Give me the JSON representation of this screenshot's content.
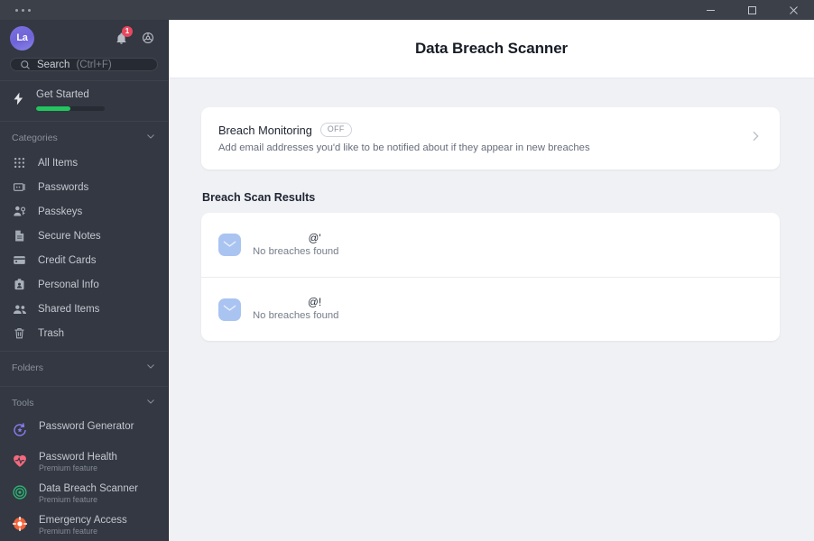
{
  "titlebar": {
    "menu_dots": "•••",
    "minimize_label": "Minimize",
    "maximize_label": "Maximize",
    "close_label": "Close"
  },
  "sidebar": {
    "avatar_initials": "La",
    "notification_count": "1",
    "search": {
      "label": "Search",
      "hint": "(Ctrl+F)",
      "placeholder": "Search (Ctrl+F)"
    },
    "get_started": {
      "label": "Get Started",
      "progress_percent": 50
    },
    "categories_header": "Categories",
    "categories": [
      {
        "label": "All Items",
        "icon": "grid-icon"
      },
      {
        "label": "Passwords",
        "icon": "password-icon"
      },
      {
        "label": "Passkeys",
        "icon": "passkey-icon"
      },
      {
        "label": "Secure Notes",
        "icon": "note-icon"
      },
      {
        "label": "Credit Cards",
        "icon": "credit-card-icon"
      },
      {
        "label": "Personal Info",
        "icon": "id-badge-icon"
      },
      {
        "label": "Shared Items",
        "icon": "people-icon"
      },
      {
        "label": "Trash",
        "icon": "trash-icon"
      }
    ],
    "folders_header": "Folders",
    "tools_header": "Tools",
    "tools": [
      {
        "label": "Password Generator",
        "sub": "",
        "icon": "generator-icon",
        "color": "#8b7cf0"
      },
      {
        "label": "Password Health",
        "sub": "Premium feature",
        "icon": "heart-pulse-icon",
        "color": "#f4697e"
      },
      {
        "label": "Data Breach Scanner",
        "sub": "Premium feature",
        "icon": "radar-icon",
        "color": "#2bb673"
      },
      {
        "label": "Emergency Access",
        "sub": "Premium feature",
        "icon": "lifebuoy-icon",
        "color": "#f2633a"
      }
    ]
  },
  "main": {
    "title": "Data Breach Scanner",
    "monitoring": {
      "title": "Breach Monitoring",
      "status_badge": "OFF",
      "description": "Add email addresses you'd like to be notified about if they appear in new breaches",
      "chevron": "chevron-right-icon"
    },
    "results_title": "Breach Scan Results",
    "results": [
      {
        "email": "@'",
        "status": "No breaches found",
        "icon": "envelope-icon"
      },
      {
        "email": "@!",
        "status": "No breaches found",
        "icon": "envelope-icon"
      }
    ]
  },
  "colors": {
    "sidebar_bg": "#333842",
    "titlebar_bg": "#3b4049",
    "main_bg": "#f0f1f5",
    "header_bg": "#ffffff",
    "accent_green": "#22c55e",
    "badge_red": "#e8485f",
    "avatar_purple": "#7b72e0"
  }
}
